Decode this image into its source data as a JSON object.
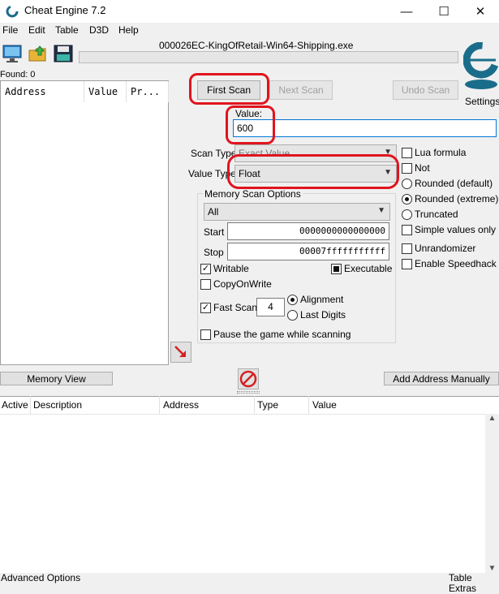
{
  "window": {
    "title": "Cheat Engine 7.2",
    "minimize": "—",
    "maximize": "☐",
    "close": "✕"
  },
  "menu": [
    "File",
    "Edit",
    "Table",
    "D3D",
    "Help"
  ],
  "process_name": "000026EC-KingOfRetail-Win64-Shipping.exe",
  "settings_label": "Settings",
  "found_label": "Found: 0",
  "results_columns": [
    "Address",
    "Value",
    "Pr..."
  ],
  "scan": {
    "first_scan": "First Scan",
    "next_scan": "Next Scan",
    "undo_scan": "Undo Scan",
    "value_label": "Value:",
    "value": "600",
    "scan_type_label": "Scan Type",
    "scan_type": "Exact Value",
    "value_type_label": "Value Type",
    "value_type": "Float"
  },
  "memory": {
    "title": "Memory Scan Options",
    "region": "All",
    "start_label": "Start",
    "start": "0000000000000000",
    "stop_label": "Stop",
    "stop": "00007fffffffffff",
    "writable": "Writable",
    "executable": "Executable",
    "copy_on_write": "CopyOnWrite",
    "fast_scan": "Fast Scan",
    "fast_scan_value": "4",
    "alignment": "Alignment",
    "last_digits": "Last Digits",
    "pause": "Pause the game while scanning"
  },
  "options": {
    "lua_formula": "Lua formula",
    "not": "Not",
    "rounded_default": "Rounded (default)",
    "rounded_extreme": "Rounded (extreme)",
    "truncated": "Truncated",
    "simple_values": "Simple values only",
    "unrandomizer": "Unrandomizer",
    "speedhack": "Enable Speedhack"
  },
  "memory_view": "Memory View",
  "add_address": "Add Address Manually",
  "address_columns": [
    "Active",
    "Description",
    "Address",
    "Type",
    "Value"
  ],
  "advanced_options": "Advanced Options",
  "table_extras": "Table Extras",
  "colors": {
    "annotation": "#e0141e",
    "input_focus": "#0078d7"
  }
}
